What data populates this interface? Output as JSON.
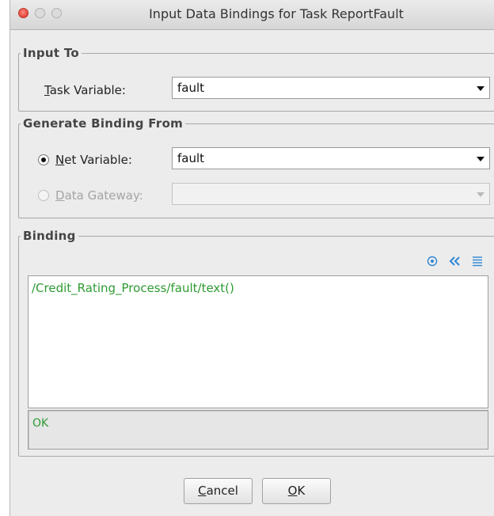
{
  "window": {
    "title": "Input Data Bindings for Task ReportFault"
  },
  "input_to": {
    "legend": "Input To",
    "task_variable_label_mnemonic": "T",
    "task_variable_label_rest": "ask Variable:",
    "task_variable_value": "fault"
  },
  "generate_from": {
    "legend": "Generate Binding From",
    "net_variable_label_mnemonic": "N",
    "net_variable_label_rest": "et Variable:",
    "net_variable_value": "fault",
    "net_variable_selected": true,
    "data_gateway_label_mnemonic": "D",
    "data_gateway_label_rest": "ata Gateway:",
    "data_gateway_value": "",
    "data_gateway_enabled": false
  },
  "binding": {
    "legend": "Binding",
    "toolbar_icons": [
      "target-icon",
      "double-chevron-left-icon",
      "align-lines-icon"
    ],
    "expression": "/Credit_Rating_Process/fault/text()",
    "status": "OK"
  },
  "buttons": {
    "cancel_mnemonic": "C",
    "cancel_rest": "ancel",
    "ok_mnemonic": "O",
    "ok_rest": "K"
  },
  "colors": {
    "accent_icon": "#2f86d6",
    "ok_text": "#2e9b32"
  }
}
